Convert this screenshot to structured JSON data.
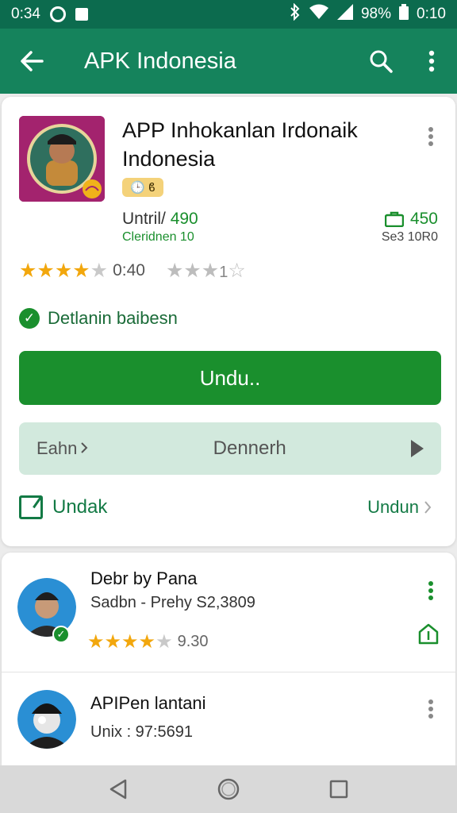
{
  "status_bar": {
    "time_left": "0:34",
    "battery": "98%",
    "time_right": "0:10"
  },
  "app_bar": {
    "title": "APK Indonesia",
    "back_icon": "arrow-left-icon",
    "search_icon": "search-icon",
    "menu_icon": "more-vert-icon"
  },
  "app": {
    "name": "APP Inhokanlan Irdonaik Indonesia",
    "badge": "🕒 ϐ",
    "stat_left_label": "Untril/",
    "stat_left_value": "490",
    "stat_left_sub": "Cleridnen 10",
    "stat_right_value": "450",
    "stat_right_sub": "Se3 10R0",
    "rating_value": "0:40",
    "rating_stars": 4.5,
    "secondary_stars_filled": 3,
    "secondary_stars_total": 4,
    "secondary_star_label": "1",
    "verified_text": "Detlanin baibesn",
    "download_button": "Undu..",
    "secondary_button_left": "Eahn",
    "secondary_button_center": "Dennerh",
    "footer_left": "Undak",
    "footer_right": "Undun"
  },
  "list": [
    {
      "title": "Debr by Pana",
      "subtitle": "Sadbn - Prehy  S2,3809",
      "rating_value": "9.30",
      "rating_stars": 3.5
    },
    {
      "title": "APIPen lantani",
      "subtitle": "Unix : 97:5691"
    }
  ],
  "colors": {
    "status_bar": "#0c6b4e",
    "app_bar": "#15835c",
    "primary_green": "#1a8f2d",
    "secondary_button": "#d2e9dd",
    "app_icon_bg": "#a3236e",
    "star": "#f2a70d"
  }
}
